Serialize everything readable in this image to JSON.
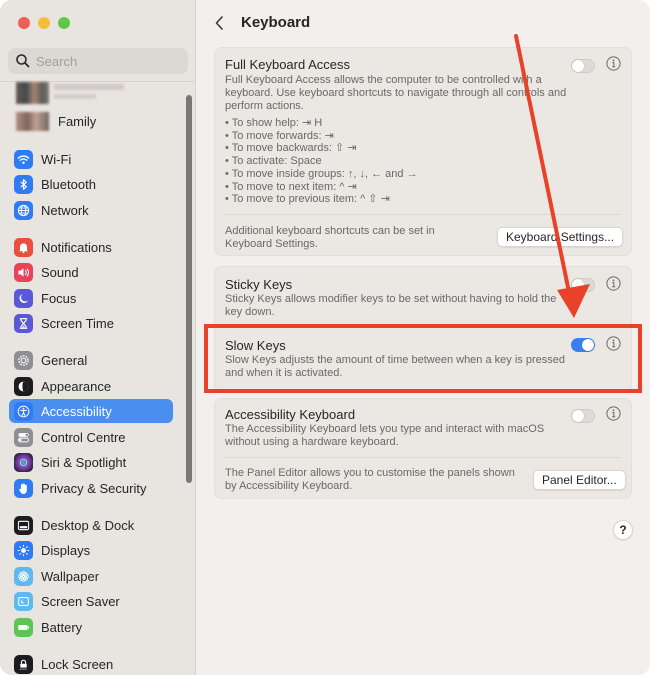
{
  "window": {
    "controls": [
      "close",
      "minimize",
      "zoom"
    ]
  },
  "sidebar": {
    "search": {
      "placeholder": "Search",
      "value": ""
    },
    "profile": {
      "name_obscured": true
    },
    "family_label": "Family",
    "items": [
      {
        "label": "Wi-Fi",
        "icon": "wifi-icon",
        "color": "#2f7bf2"
      },
      {
        "label": "Bluetooth",
        "icon": "bluetooth-icon",
        "color": "#2f7bf2"
      },
      {
        "label": "Network",
        "icon": "globe-icon",
        "color": "#2f7bf2"
      },
      {
        "label": "Notifications",
        "icon": "bell-icon",
        "color": "#ea4e3d"
      },
      {
        "label": "Sound",
        "icon": "speaker-icon",
        "color": "#e9435a"
      },
      {
        "label": "Focus",
        "icon": "moon-icon",
        "color": "#5b58d6"
      },
      {
        "label": "Screen Time",
        "icon": "hourglass-icon",
        "color": "#5b58d6"
      },
      {
        "label": "General",
        "icon": "gear-icon",
        "color": "#8e8e93"
      },
      {
        "label": "Appearance",
        "icon": "appearance-icon",
        "color": "#1c1c1e"
      },
      {
        "label": "Accessibility",
        "icon": "accessibility-icon",
        "color": "#2f7bf2",
        "active": true
      },
      {
        "label": "Control Centre",
        "icon": "control-centre-icon",
        "color": "#8e8e93"
      },
      {
        "label": "Siri & Spotlight",
        "icon": "siri-icon",
        "color": "#3a2d4d"
      },
      {
        "label": "Privacy & Security",
        "icon": "hand-icon",
        "color": "#2f7bf2"
      },
      {
        "label": "Desktop & Dock",
        "icon": "dock-icon",
        "color": "#1c1c1e"
      },
      {
        "label": "Displays",
        "icon": "sun-icon",
        "color": "#2f7bf2"
      },
      {
        "label": "Wallpaper",
        "icon": "flower-icon",
        "color": "#5fb8f0"
      },
      {
        "label": "Screen Saver",
        "icon": "screen-saver-icon",
        "color": "#5fb8f0"
      },
      {
        "label": "Battery",
        "icon": "battery-icon",
        "color": "#5ec454"
      },
      {
        "label": "Lock Screen",
        "icon": "lock-icon",
        "color": "#1c1c1e"
      }
    ]
  },
  "main": {
    "back_label": "Back",
    "title": "Keyboard",
    "full_keyboard_access": {
      "title": "Full Keyboard Access",
      "description": "Full Keyboard Access allows the computer to be controlled with a keyboard. Use keyboard shortcuts to navigate through all controls and perform actions.",
      "enabled": false,
      "shortcuts": [
        "• To show help: ⇥ H",
        "• To move forwards: ⇥",
        "• To move backwards: ⇧ ⇥",
        "• To activate: Space",
        "• To move inside groups: ↑, ↓, ← and →",
        "• To move to next item: ^ ⇥",
        "• To move to previous item: ^ ⇧ ⇥"
      ],
      "footer_text": "Additional keyboard shortcuts can be set in Keyboard Settings.",
      "button_label": "Keyboard Settings..."
    },
    "sticky_keys": {
      "title": "Sticky Keys",
      "description": "Sticky Keys allows modifier keys to be set without having to hold the key down.",
      "enabled": false
    },
    "slow_keys": {
      "title": "Slow Keys",
      "description": "Slow Keys adjusts the amount of time between when a key is pressed and when it is activated.",
      "enabled": true
    },
    "accessibility_keyboard": {
      "title": "Accessibility Keyboard",
      "description": "The Accessibility Keyboard lets you type and interact with macOS without using a hardware keyboard.",
      "enabled": false,
      "footer_text": "The Panel Editor allows you to customise the panels shown by Accessibility Keyboard.",
      "button_label": "Panel Editor..."
    },
    "help_label": "?"
  },
  "annotation": {
    "color": "#e8432a",
    "highlights": "Slow Keys"
  }
}
